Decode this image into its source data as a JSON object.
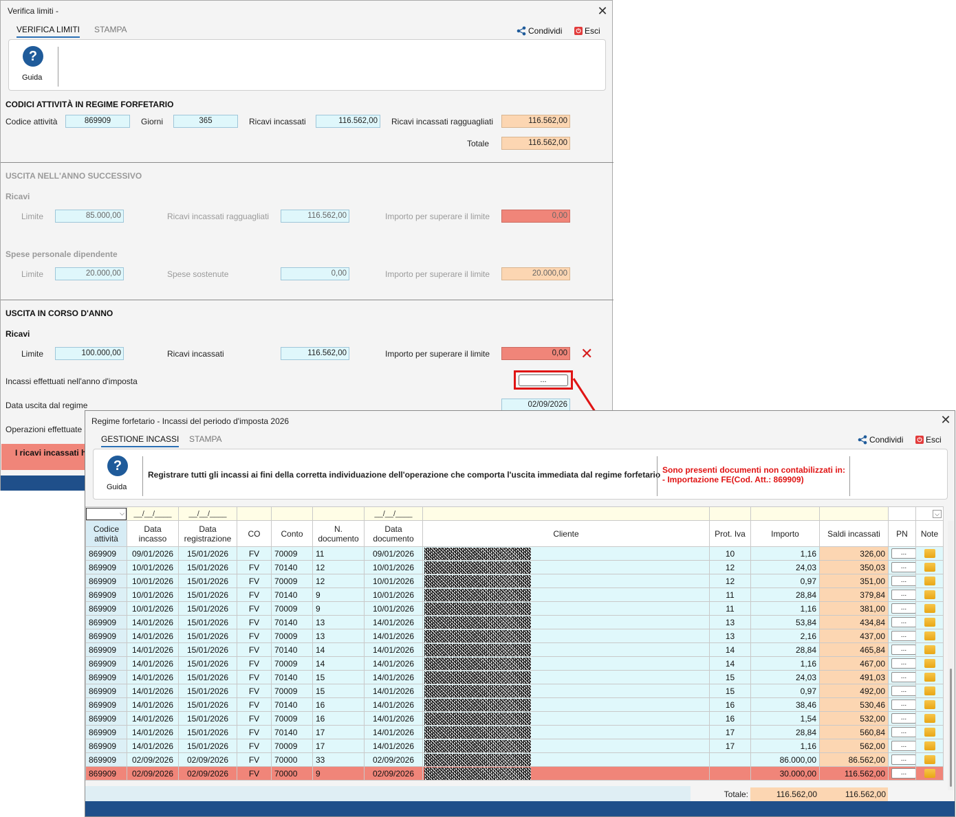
{
  "win1": {
    "title": "Verifica limiti -",
    "tabs": [
      {
        "label": "VERIFICA LIMITI"
      },
      {
        "label": "STAMPA"
      }
    ],
    "share_label": "Condividi",
    "exit_label": "Esci",
    "guide_label": "Guida",
    "codici": {
      "title": "CODICI ATTIVITÀ IN REGIME FORFETARIO",
      "codice_label": "Codice attività",
      "codice_value": "869909",
      "giorni_label": "Giorni",
      "giorni_value": "365",
      "ricavi_label": "Ricavi incassati",
      "ricavi_value": "116.562,00",
      "ragg_label": "Ricavi incassati ragguagliati",
      "ragg_value": "116.562,00",
      "totale_label": "Totale",
      "totale_value": "116.562,00"
    },
    "successivo": {
      "title": "USCITA NELL'ANNO SUCCESSIVO",
      "ricavi_title": "Ricavi",
      "limite_label": "Limite",
      "limite_value": "85.000,00",
      "ragg_label": "Ricavi incassati ragguagliati",
      "ragg_value": "116.562,00",
      "importo_label": "Importo per superare il limite",
      "importo_value": "0,00",
      "spese_title": "Spese personale dipendente",
      "spese_limite_label": "Limite",
      "spese_limite_value": "20.000,00",
      "sostenute_label": "Spese sostenute",
      "sostenute_value": "0,00",
      "spese_importo_label": "Importo per superare il limite",
      "spese_importo_value": "20.000,00"
    },
    "corso": {
      "title": "USCITA IN CORSO D'ANNO",
      "ricavi_title": "Ricavi",
      "limite_label": "Limite",
      "limite_value": "100.000,00",
      "ricavi_label": "Ricavi incassati",
      "ricavi_value": "116.562,00",
      "importo_label": "Importo per superare il limite",
      "importo_value": "0,00",
      "incassi_label": "Incassi effettuati nell'anno d'imposta",
      "incassi_btn": "...",
      "data_label": "Data uscita dal regime",
      "data_value": "02/09/2026",
      "operazioni_label": "Operazioni effettuate s",
      "alert_text": "I ricavi incassati ha"
    }
  },
  "win2": {
    "title": "Regime forfetario - Incassi del periodo d'imposta 2026",
    "tabs": [
      {
        "label": "GESTIONE INCASSI"
      },
      {
        "label": "STAMPA"
      }
    ],
    "share_label": "Condividi",
    "exit_label": "Esci",
    "guide_label": "Guida",
    "instruction": "Registrare tutti gli incassi ai fini della corretta individuazione dell'operazione che comporta l'uscita immediata dal regime forfetario",
    "warning_line1": "Sono presenti documenti non contabilizzati in:",
    "warning_line2": "- Importazione FE(Cod. Att.: 869909)",
    "filter": {
      "date_placeholder": "__/__/____"
    },
    "columns": [
      "Codice attività",
      "Data incasso",
      "Data registrazione",
      "CO",
      "Conto",
      "N. documento",
      "Data documento",
      "Cliente",
      "Prot. Iva",
      "Importo",
      "Saldi incassati",
      "PN",
      "Note"
    ],
    "rows": [
      {
        "cod": "869909",
        "inc": "09/01/2026",
        "reg": "15/01/2026",
        "co": "FV",
        "conto": "70009",
        "ndoc": "11",
        "ddoc": "09/01/2026",
        "prot": "10",
        "imp": "1,16",
        "saldo": "326,00"
      },
      {
        "cod": "869909",
        "inc": "10/01/2026",
        "reg": "15/01/2026",
        "co": "FV",
        "conto": "70140",
        "ndoc": "12",
        "ddoc": "10/01/2026",
        "prot": "12",
        "imp": "24,03",
        "saldo": "350,03"
      },
      {
        "cod": "869909",
        "inc": "10/01/2026",
        "reg": "15/01/2026",
        "co": "FV",
        "conto": "70009",
        "ndoc": "12",
        "ddoc": "10/01/2026",
        "prot": "12",
        "imp": "0,97",
        "saldo": "351,00"
      },
      {
        "cod": "869909",
        "inc": "10/01/2026",
        "reg": "15/01/2026",
        "co": "FV",
        "conto": "70140",
        "ndoc": "9",
        "ddoc": "10/01/2026",
        "prot": "11",
        "imp": "28,84",
        "saldo": "379,84"
      },
      {
        "cod": "869909",
        "inc": "10/01/2026",
        "reg": "15/01/2026",
        "co": "FV",
        "conto": "70009",
        "ndoc": "9",
        "ddoc": "10/01/2026",
        "prot": "11",
        "imp": "1,16",
        "saldo": "381,00"
      },
      {
        "cod": "869909",
        "inc": "14/01/2026",
        "reg": "15/01/2026",
        "co": "FV",
        "conto": "70140",
        "ndoc": "13",
        "ddoc": "14/01/2026",
        "prot": "13",
        "imp": "53,84",
        "saldo": "434,84"
      },
      {
        "cod": "869909",
        "inc": "14/01/2026",
        "reg": "15/01/2026",
        "co": "FV",
        "conto": "70009",
        "ndoc": "13",
        "ddoc": "14/01/2026",
        "prot": "13",
        "imp": "2,16",
        "saldo": "437,00"
      },
      {
        "cod": "869909",
        "inc": "14/01/2026",
        "reg": "15/01/2026",
        "co": "FV",
        "conto": "70140",
        "ndoc": "14",
        "ddoc": "14/01/2026",
        "prot": "14",
        "imp": "28,84",
        "saldo": "465,84"
      },
      {
        "cod": "869909",
        "inc": "14/01/2026",
        "reg": "15/01/2026",
        "co": "FV",
        "conto": "70009",
        "ndoc": "14",
        "ddoc": "14/01/2026",
        "prot": "14",
        "imp": "1,16",
        "saldo": "467,00"
      },
      {
        "cod": "869909",
        "inc": "14/01/2026",
        "reg": "15/01/2026",
        "co": "FV",
        "conto": "70140",
        "ndoc": "15",
        "ddoc": "14/01/2026",
        "prot": "15",
        "imp": "24,03",
        "saldo": "491,03"
      },
      {
        "cod": "869909",
        "inc": "14/01/2026",
        "reg": "15/01/2026",
        "co": "FV",
        "conto": "70009",
        "ndoc": "15",
        "ddoc": "14/01/2026",
        "prot": "15",
        "imp": "0,97",
        "saldo": "492,00"
      },
      {
        "cod": "869909",
        "inc": "14/01/2026",
        "reg": "15/01/2026",
        "co": "FV",
        "conto": "70140",
        "ndoc": "16",
        "ddoc": "14/01/2026",
        "prot": "16",
        "imp": "38,46",
        "saldo": "530,46"
      },
      {
        "cod": "869909",
        "inc": "14/01/2026",
        "reg": "15/01/2026",
        "co": "FV",
        "conto": "70009",
        "ndoc": "16",
        "ddoc": "14/01/2026",
        "prot": "16",
        "imp": "1,54",
        "saldo": "532,00"
      },
      {
        "cod": "869909",
        "inc": "14/01/2026",
        "reg": "15/01/2026",
        "co": "FV",
        "conto": "70140",
        "ndoc": "17",
        "ddoc": "14/01/2026",
        "prot": "17",
        "imp": "28,84",
        "saldo": "560,84"
      },
      {
        "cod": "869909",
        "inc": "14/01/2026",
        "reg": "15/01/2026",
        "co": "FV",
        "conto": "70009",
        "ndoc": "17",
        "ddoc": "14/01/2026",
        "prot": "17",
        "imp": "1,16",
        "saldo": "562,00"
      },
      {
        "cod": "869909",
        "inc": "02/09/2026",
        "reg": "02/09/2026",
        "co": "FV",
        "conto": "70000",
        "ndoc": "33",
        "ddoc": "02/09/2026",
        "prot": "",
        "imp": "86.000,00",
        "saldo": "86.562,00"
      },
      {
        "cod": "869909",
        "inc": "02/09/2026",
        "reg": "02/09/2026",
        "co": "FV",
        "conto": "70000",
        "ndoc": "9",
        "ddoc": "02/09/2026",
        "prot": "",
        "imp": "30.000,00",
        "saldo": "116.562,00",
        "highlight": true
      }
    ],
    "row_btn_label": "...",
    "totale_label": "Totale:",
    "totale_importo": "116.562,00",
    "totale_saldi": "116.562,00"
  }
}
